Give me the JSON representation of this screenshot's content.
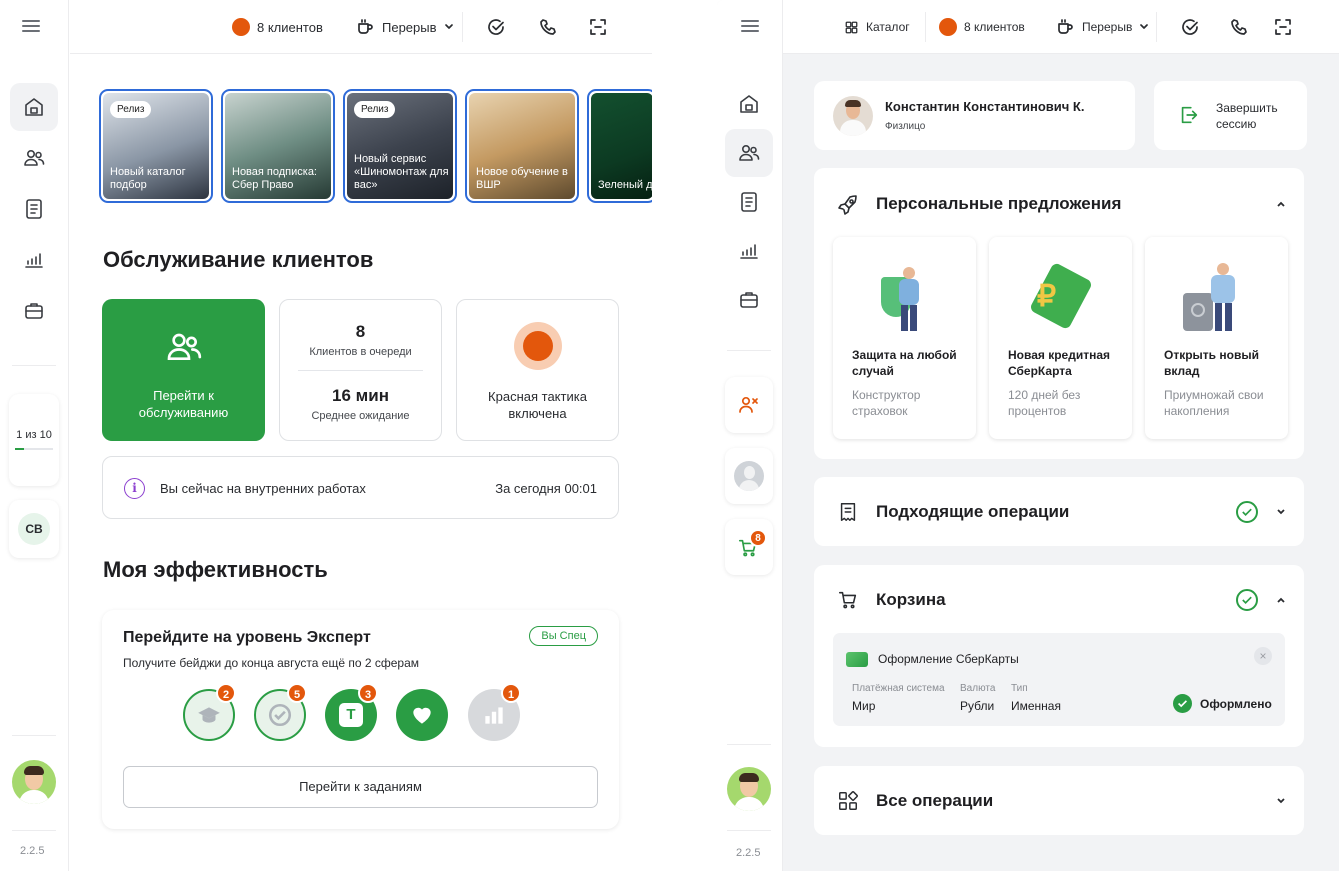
{
  "left": {
    "topbar": {
      "clients": "8 клиентов",
      "break": "Перерыв"
    },
    "stories": [
      {
        "badge": "Релиз",
        "caption": "Новый каталог подбор"
      },
      {
        "badge": "",
        "caption": "Новая подписка: Сбер Право"
      },
      {
        "badge": "Релиз",
        "caption": "Новый сервис «Шиномонтаж для вас»"
      },
      {
        "badge": "",
        "caption": "Новое обучение в ВШР"
      },
      {
        "badge": "",
        "caption": "Зеленый д"
      }
    ],
    "service_title": "Обслуживание клиентов",
    "go_service": "Перейти к обслуживанию",
    "queue_count": "8",
    "queue_label": "Клиентов в очереди",
    "wait_value": "16 мин",
    "wait_label": "Среднее ожидание",
    "tactic": "Красная тактика включена",
    "info_text": "Вы сейчас на внутренних работах",
    "info_today": "За сегодня 00:01",
    "efficiency_title": "Моя эффективность",
    "level_title": "Перейдите на уровень Эксперт",
    "level_chip": "Вы Спец",
    "level_sub": "Получите бейджи до конца августа ещё по 2 сферам",
    "badges": [
      {
        "count": "2"
      },
      {
        "count": "5"
      },
      {
        "count": "3",
        "letter": "T"
      },
      {
        "count": ""
      },
      {
        "count": "1"
      }
    ],
    "tasks_button": "Перейти к заданиям",
    "pager": "1 из 10",
    "initials": "СВ",
    "version": "2.2.5"
  },
  "right": {
    "topbar": {
      "catalog": "Каталог",
      "clients": "8 клиентов",
      "break": "Перерыв"
    },
    "client_name": "Константин Константинович К.",
    "client_type": "Физлицо",
    "end_session": "Завершить сессию",
    "offers_title": "Персональные предложения",
    "offers": [
      {
        "title": "Защита на любой случай",
        "sub": "Конструктор страховок"
      },
      {
        "title": "Новая кредитная СберКарта",
        "sub": "120 дней без процентов"
      },
      {
        "title": "Открыть новый вклад",
        "sub": "Приумножай свои накопления"
      }
    ],
    "ops_title": "Подходящие операции",
    "cart_title": "Корзина",
    "cart_item": "Оформление СберКарты",
    "cart_fields": [
      {
        "label": "Платёжная система",
        "value": "Мир"
      },
      {
        "label": "Валюта",
        "value": "Рубли"
      },
      {
        "label": "Тип",
        "value": "Именная"
      }
    ],
    "cart_status": "Оформлено",
    "all_ops_title": "Все операции",
    "cart_badge": "8",
    "version": "2.2.5"
  },
  "colors": {
    "green": "#2a9d44",
    "orange": "#e3570c",
    "story_border": "#2f6bd8"
  }
}
